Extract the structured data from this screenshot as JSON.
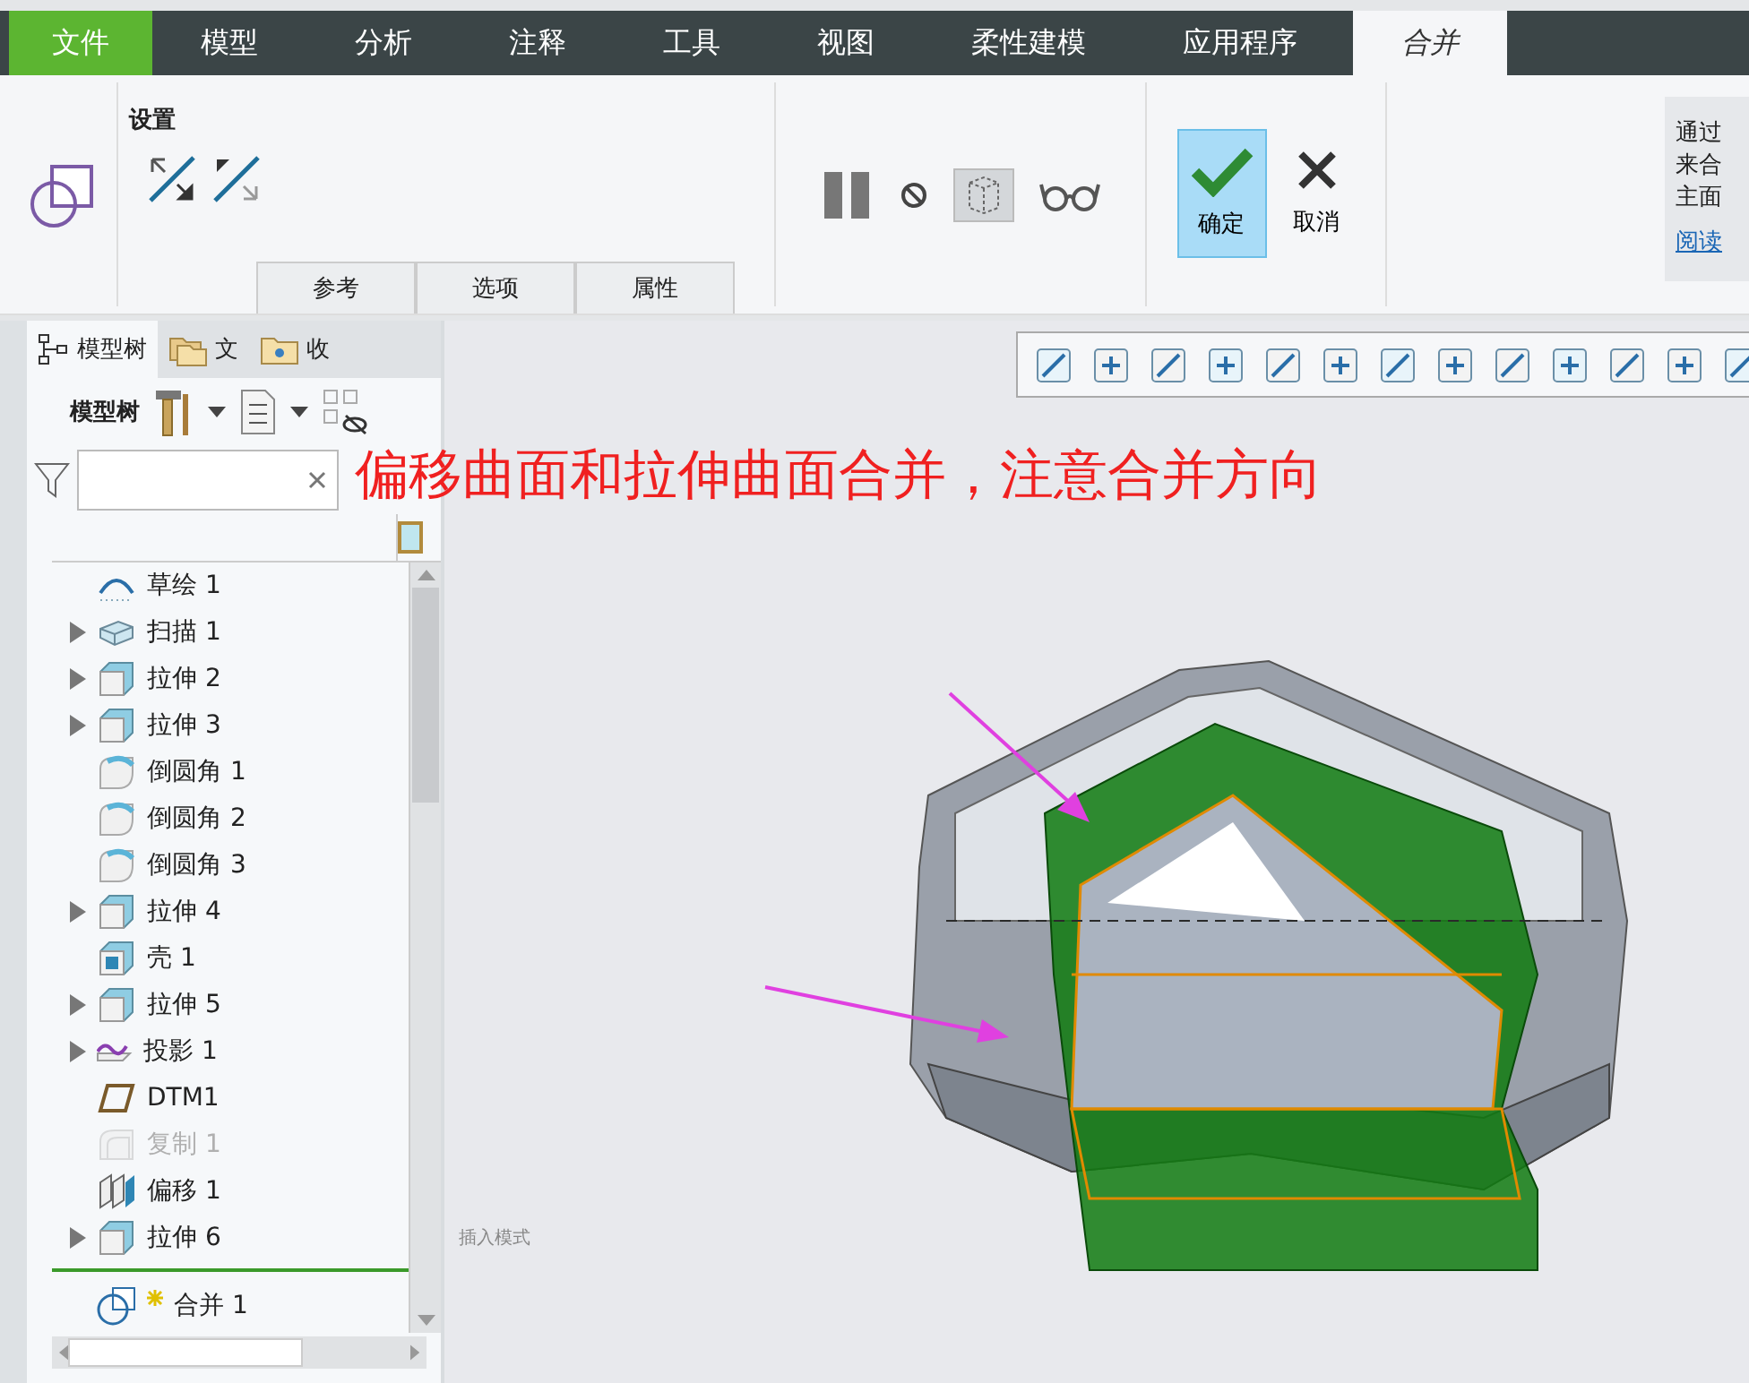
{
  "tabs": [
    {
      "label": "文件",
      "kind": "file",
      "selected": false
    },
    {
      "label": "模型",
      "kind": "normal",
      "selected": false
    },
    {
      "label": "分析",
      "kind": "normal",
      "selected": false
    },
    {
      "label": "注释",
      "kind": "normal",
      "selected": false
    },
    {
      "label": "工具",
      "kind": "normal",
      "selected": false
    },
    {
      "label": "视图",
      "kind": "normal",
      "selected": false
    },
    {
      "label": "柔性建模",
      "kind": "normal",
      "selected": false
    },
    {
      "label": "应用程序",
      "kind": "normal",
      "selected": false
    },
    {
      "label": "合并",
      "kind": "normal",
      "selected": true
    }
  ],
  "ribbon": {
    "settings_label": "设置",
    "panel_tabs": [
      "参考",
      "选项",
      "属性"
    ],
    "preview_checked": true,
    "ok": "确定",
    "cancel": "取消",
    "help_lines": [
      "通过",
      "来合",
      "主面"
    ],
    "help_link": "阅读"
  },
  "model_tree": {
    "tabs": [
      {
        "label": "模型树",
        "kind": "tree",
        "selected": true
      },
      {
        "label": "文",
        "kind": "folder",
        "selected": false
      },
      {
        "label": "收",
        "kind": "favorites",
        "selected": false
      }
    ],
    "header": "模型树",
    "items": [
      {
        "label": "草绘 1",
        "kind": "sketch",
        "expandable": false,
        "disabled": false,
        "new": false
      },
      {
        "label": "扫描 1",
        "kind": "sweep",
        "expandable": true,
        "disabled": false,
        "new": false
      },
      {
        "label": "拉伸 2",
        "kind": "extrude",
        "expandable": true,
        "disabled": false,
        "new": false
      },
      {
        "label": "拉伸 3",
        "kind": "extrude",
        "expandable": true,
        "disabled": false,
        "new": false
      },
      {
        "label": "倒圆角 1",
        "kind": "round",
        "expandable": false,
        "disabled": false,
        "new": false
      },
      {
        "label": "倒圆角 2",
        "kind": "round",
        "expandable": false,
        "disabled": false,
        "new": false
      },
      {
        "label": "倒圆角 3",
        "kind": "round",
        "expandable": false,
        "disabled": false,
        "new": false
      },
      {
        "label": "拉伸 4",
        "kind": "extrude",
        "expandable": true,
        "disabled": false,
        "new": false
      },
      {
        "label": "壳 1",
        "kind": "shell",
        "expandable": false,
        "disabled": false,
        "new": false
      },
      {
        "label": "拉伸 5",
        "kind": "extrude",
        "expandable": true,
        "disabled": false,
        "new": false
      },
      {
        "label": "投影 1",
        "kind": "project",
        "expandable": true,
        "disabled": false,
        "new": false
      },
      {
        "label": "DTM1",
        "kind": "datum",
        "expandable": false,
        "disabled": false,
        "new": false
      },
      {
        "label": "复制 1",
        "kind": "copy",
        "expandable": false,
        "disabled": true,
        "new": false
      },
      {
        "label": "偏移 1",
        "kind": "offset",
        "expandable": false,
        "disabled": false,
        "new": false
      },
      {
        "label": "拉伸 6",
        "kind": "extrude",
        "expandable": true,
        "disabled": false,
        "new": false
      }
    ],
    "pending": [
      {
        "label": "合并 1",
        "kind": "merge",
        "expandable": false,
        "disabled": false,
        "new": true
      }
    ]
  },
  "annotation": "偏移曲面和拉伸曲面合并，注意合并方向",
  "status_text": "插入模式"
}
